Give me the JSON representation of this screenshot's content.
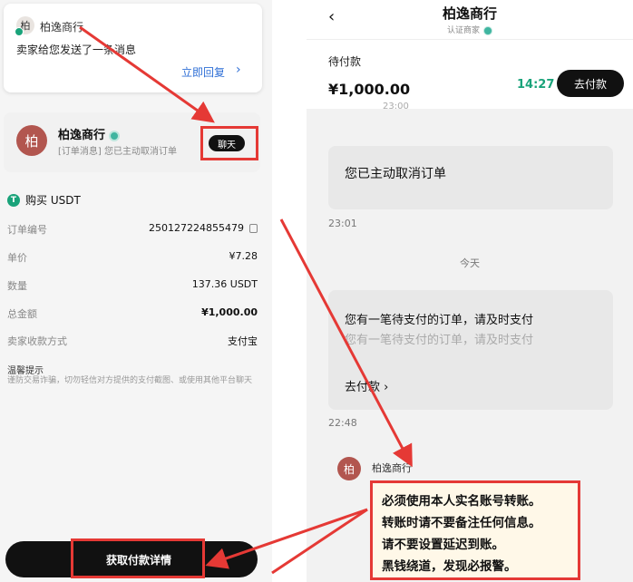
{
  "left": {
    "notification": {
      "avatar_char": "柏",
      "shop_name": "柏逸商行",
      "message": "卖家给您发送了一条消息",
      "reply": "立即回复"
    },
    "seller": {
      "avatar_char": "柏",
      "name": "柏逸商行",
      "subtitle": "[订单消息] 您已主动取消订单",
      "chat_button": "聊天"
    },
    "buy_title": "购买 USDT",
    "details": [
      {
        "label": "订单编号",
        "value": "250127224855479"
      },
      {
        "label": "单价",
        "value": "¥7.28"
      },
      {
        "label": "数量",
        "value": "137.36 USDT"
      },
      {
        "label": "总金额",
        "value": "¥1,000.00"
      },
      {
        "label": "卖家收款方式",
        "value": "支付宝"
      }
    ],
    "tips_title": "温馨提示",
    "tips_text": "谨防交易诈骗，切勿轻信对方提供的支付截图、或使用其他平台聊天",
    "pay_details_button": "获取付款详情"
  },
  "right": {
    "title": "柏逸商行",
    "subtitle": "认证商家",
    "pending_label": "待付款",
    "amount": "¥1,000.00",
    "countdown": "14:27",
    "go_pay": "去付款",
    "faded_time": "23:00",
    "msg1": "您已主动取消订单",
    "time1": "23:01",
    "today": "今天",
    "msg2_line1": "您有一笔待支付的订单，请及时支付",
    "msg2_line2": "您有一笔待支付的订单，请及时支付",
    "msg2_link": "去付款",
    "time2": "22:48",
    "sender_avatar_char": "柏",
    "sender_name": "柏逸商行",
    "warning_lines": [
      "必须使用本人实名账号转账。",
      "转账时请不要备注任何信息。",
      "请不要设置延迟到账。",
      "黑钱绕道，发现必报警。"
    ]
  },
  "colors": {
    "highlight": "#e53935",
    "accent_green": "#1aa37a",
    "link_blue": "#2f6fd6"
  }
}
